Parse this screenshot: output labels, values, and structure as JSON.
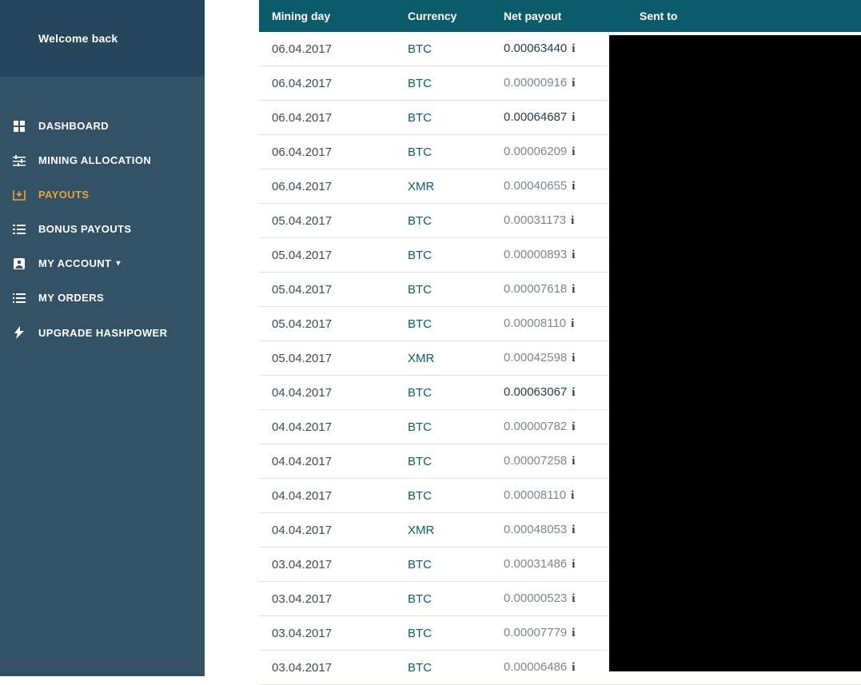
{
  "sidebar": {
    "welcome": "Welcome back",
    "items": [
      {
        "label": "DASHBOARD",
        "icon": "dashboard-icon",
        "active": false,
        "hasCaret": false
      },
      {
        "label": "MINING ALLOCATION",
        "icon": "sliders-icon",
        "active": false,
        "hasCaret": false
      },
      {
        "label": "PAYOUTS",
        "icon": "download-box-icon",
        "active": true,
        "hasCaret": false
      },
      {
        "label": "BONUS PAYOUTS",
        "icon": "list-icon",
        "active": false,
        "hasCaret": false
      },
      {
        "label": "MY ACCOUNT",
        "icon": "user-icon",
        "active": false,
        "hasCaret": true
      },
      {
        "label": "MY ORDERS",
        "icon": "lines-icon",
        "active": false,
        "hasCaret": false
      },
      {
        "label": "UPGRADE HASHPOWER",
        "icon": "bolt-icon",
        "active": false,
        "hasCaret": false
      }
    ]
  },
  "table": {
    "headers": {
      "mining_day": "Mining day",
      "currency": "Currency",
      "net_payout": "Net payout",
      "sent_to": "Sent to"
    },
    "rows": [
      {
        "mining_day": "06.04.2017",
        "currency": "BTC",
        "net_payout": "0.00063440",
        "dark": true
      },
      {
        "mining_day": "06.04.2017",
        "currency": "BTC",
        "net_payout": "0.00000916",
        "dark": false
      },
      {
        "mining_day": "06.04.2017",
        "currency": "BTC",
        "net_payout": "0.00064687",
        "dark": true
      },
      {
        "mining_day": "06.04.2017",
        "currency": "BTC",
        "net_payout": "0.00006209",
        "dark": false
      },
      {
        "mining_day": "06.04.2017",
        "currency": "XMR",
        "net_payout": "0.00040655",
        "dark": false
      },
      {
        "mining_day": "05.04.2017",
        "currency": "BTC",
        "net_payout": "0.00031173",
        "dark": false
      },
      {
        "mining_day": "05.04.2017",
        "currency": "BTC",
        "net_payout": "0.00000893",
        "dark": false
      },
      {
        "mining_day": "05.04.2017",
        "currency": "BTC",
        "net_payout": "0.00007618",
        "dark": false
      },
      {
        "mining_day": "05.04.2017",
        "currency": "BTC",
        "net_payout": "0.00008110",
        "dark": false
      },
      {
        "mining_day": "05.04.2017",
        "currency": "XMR",
        "net_payout": "0.00042598",
        "dark": false
      },
      {
        "mining_day": "04.04.2017",
        "currency": "BTC",
        "net_payout": "0.00063067",
        "dark": true
      },
      {
        "mining_day": "04.04.2017",
        "currency": "BTC",
        "net_payout": "0.00000782",
        "dark": false
      },
      {
        "mining_day": "04.04.2017",
        "currency": "BTC",
        "net_payout": "0.00007258",
        "dark": false
      },
      {
        "mining_day": "04.04.2017",
        "currency": "BTC",
        "net_payout": "0.00008110",
        "dark": false
      },
      {
        "mining_day": "04.04.2017",
        "currency": "XMR",
        "net_payout": "0.00048053",
        "dark": false
      },
      {
        "mining_day": "03.04.2017",
        "currency": "BTC",
        "net_payout": "0.00031486",
        "dark": false
      },
      {
        "mining_day": "03.04.2017",
        "currency": "BTC",
        "net_payout": "0.00000523",
        "dark": false
      },
      {
        "mining_day": "03.04.2017",
        "currency": "BTC",
        "net_payout": "0.00007779",
        "dark": false
      },
      {
        "mining_day": "03.04.2017",
        "currency": "BTC",
        "net_payout": "0.00006486",
        "dark": false
      }
    ]
  }
}
